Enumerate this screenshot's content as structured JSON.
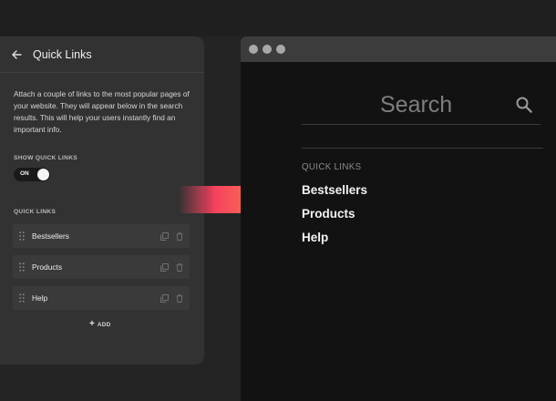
{
  "settings_panel": {
    "title": "Quick Links",
    "description": "Attach a couple of links to the most popular pages of your website. They will appear below in the search results. This will help your users instantly find an important info.",
    "show_label": "SHOW QUICK LINKS",
    "toggle_state": "ON",
    "links_label": "QUICK LINKS",
    "links": [
      {
        "label": "Bestsellers"
      },
      {
        "label": "Products"
      },
      {
        "label": "Help"
      }
    ],
    "add_label": "ADD"
  },
  "preview": {
    "search_placeholder": "Search",
    "quick_links_heading": "QUICK LINKS",
    "links": [
      "Bestsellers",
      "Products",
      "Help"
    ]
  },
  "icons": {
    "back": "arrow-left-icon",
    "drag": "drag-handle-icon",
    "duplicate": "duplicate-icon",
    "delete": "trash-icon",
    "add": "plus-icon",
    "search": "search-icon"
  },
  "colors": {
    "arrow_start": "#f5425f",
    "arrow_end": "#ff8c45",
    "panel_bg": "#323233",
    "browser_bg": "#121212"
  }
}
